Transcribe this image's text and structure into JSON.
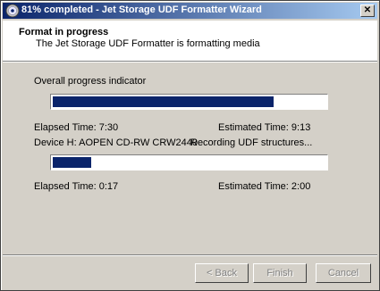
{
  "window": {
    "title": "81% completed - Jet Storage UDF Formatter Wizard",
    "close_glyph": "✕"
  },
  "header": {
    "title": "Format in progress",
    "subtitle": "The Jet Storage UDF Formatter is formatting media"
  },
  "overall": {
    "label": "Overall progress indicator",
    "progress": 0.81,
    "elapsed": "Elapsed Time: 7:30",
    "estimated": "Estimated Time: 9:13"
  },
  "device": {
    "name": "Device H:  AOPEN    CD-RW CRW2440",
    "status": "Recording UDF structures..."
  },
  "step": {
    "progress": 0.14,
    "elapsed": "Elapsed Time: 0:17",
    "estimated": "Estimated Time: 2:00"
  },
  "buttons": {
    "back": "< Back",
    "finish": "Finish",
    "cancel": "Cancel"
  },
  "colors": {
    "progress_fill": "#0a246a",
    "title_start": "#0a246a",
    "title_end": "#a6caf0"
  },
  "icons": {
    "title": "cd-disc-icon",
    "close": "close-icon"
  }
}
